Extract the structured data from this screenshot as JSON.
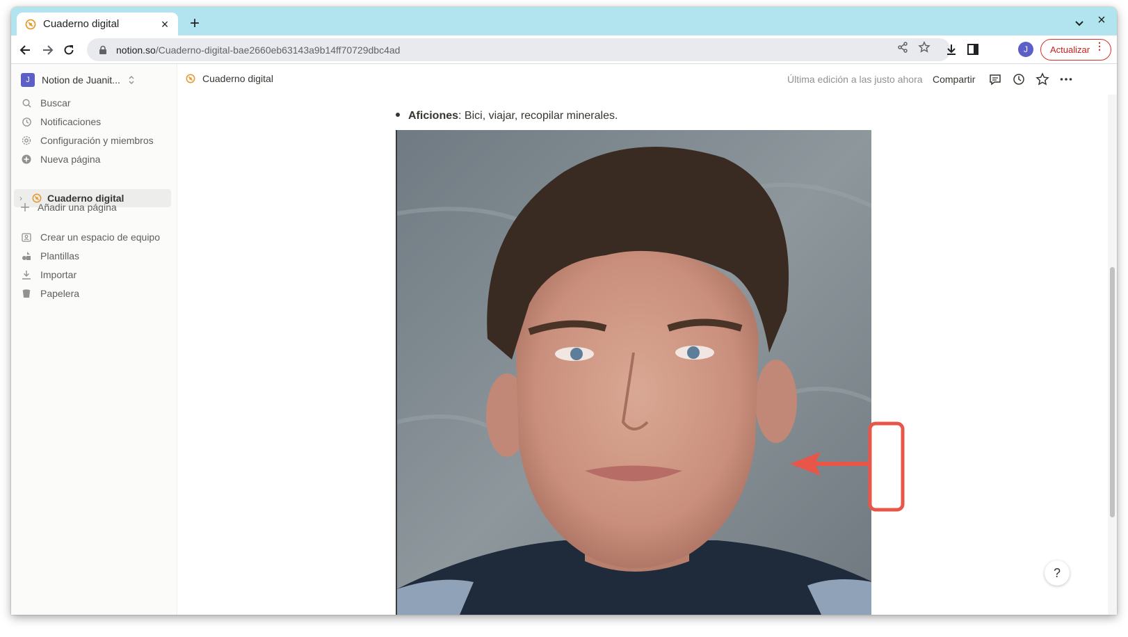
{
  "browser": {
    "tab_title": "Cuaderno digital",
    "tab_close": "×",
    "new_tab": "+",
    "window_close": "×",
    "url_host": "notion.so",
    "url_path": "/Cuaderno-digital-bae2660eb63143a9b14ff70729dbc4ad",
    "profile_initial": "J",
    "update_label": "Actualizar",
    "update_menu": "⋮"
  },
  "sidebar": {
    "workspace_initial": "J",
    "workspace_name": "Notion de Juanit...",
    "items": [
      {
        "label": "Buscar",
        "icon": "search-icon"
      },
      {
        "label": "Notificaciones",
        "icon": "clock-icon"
      },
      {
        "label": "Configuración y miembros",
        "icon": "gear-icon"
      },
      {
        "label": "Nueva página",
        "icon": "plus-circle-icon"
      }
    ],
    "page": {
      "label": "Cuaderno digital",
      "arrow": "›"
    },
    "add_page": "Añadir una página",
    "bottom_items": [
      {
        "label": "Crear un espacio de equipo",
        "icon": "team-icon"
      },
      {
        "label": "Plantillas",
        "icon": "templates-icon"
      },
      {
        "label": "Importar",
        "icon": "import-icon"
      },
      {
        "label": "Papelera",
        "icon": "trash-icon"
      }
    ]
  },
  "header": {
    "breadcrumb": "Cuaderno digital",
    "last_edited": "Última edición a las justo ahora",
    "share": "Compartir"
  },
  "content": {
    "bullet_bold": "Aficiones",
    "bullet_text": ": Bici, viajar, recopilar minerales.",
    "help": "?"
  },
  "colors": {
    "tabstrip": "#b2e4ef",
    "accent_red": "#e8564a",
    "avatar": "#5b5fc7",
    "notion_favicon": "#e79a2e"
  }
}
